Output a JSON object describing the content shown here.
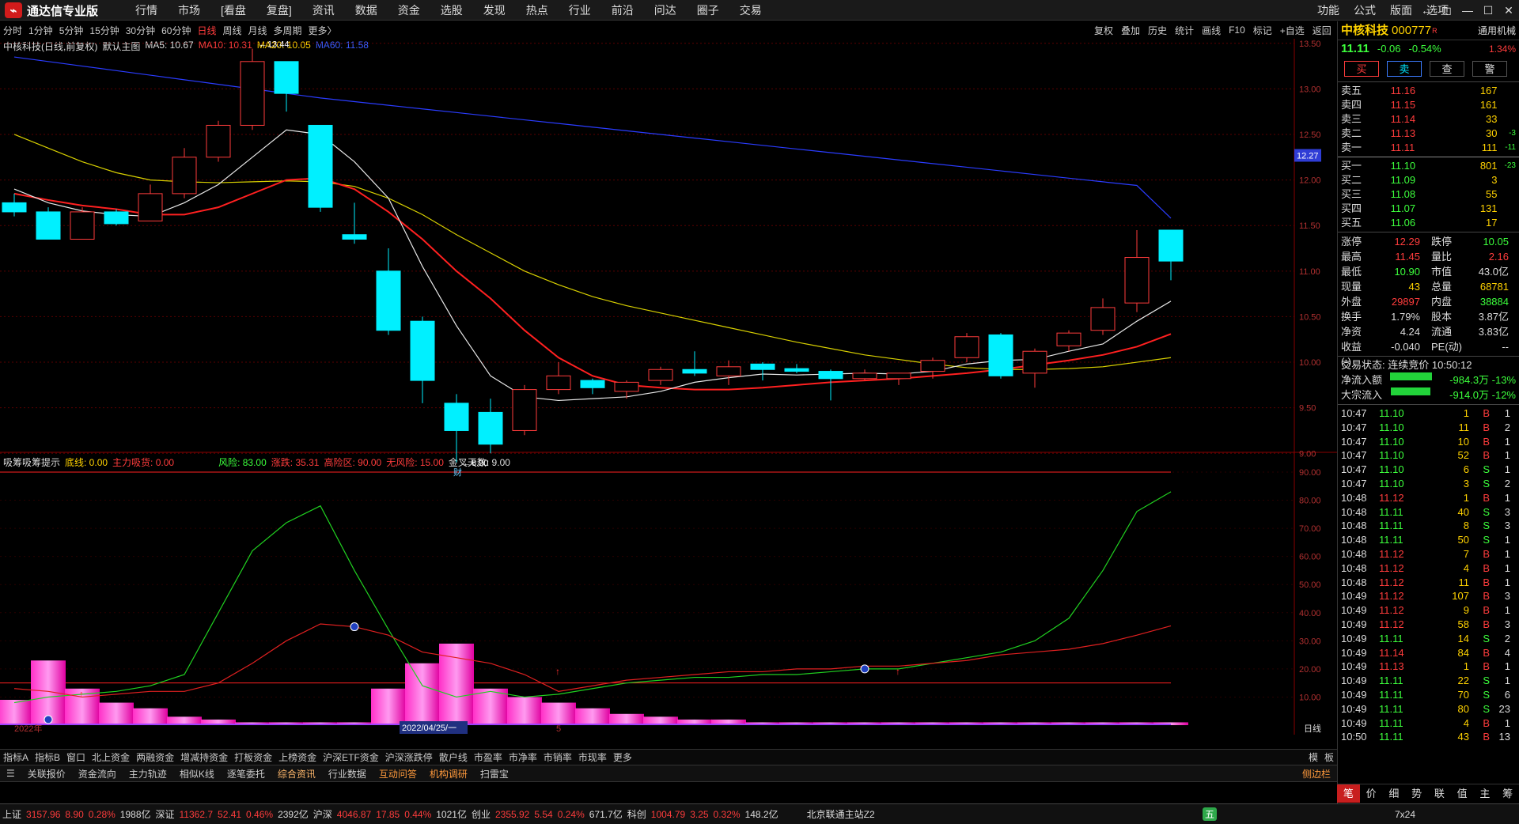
{
  "app": {
    "title": "通达信专业版",
    "menu": [
      "行情",
      "市场",
      "[看盘",
      "复盘]",
      "资讯",
      "数据",
      "资金",
      "选股",
      "发现",
      "热点",
      "行业",
      "前沿",
      "问达",
      "圈子",
      "交易"
    ],
    "right_menu": [
      "功能",
      "公式",
      "版面",
      "选项"
    ],
    "win_controls": [
      "←",
      "◻",
      "—",
      "☐",
      "✕"
    ]
  },
  "periods": [
    "分时",
    "1分钟",
    "5分钟",
    "15分钟",
    "30分钟",
    "60分钟",
    "日线",
    "周线",
    "月线",
    "多周期",
    "更多〉"
  ],
  "chart_tools": [
    "复权",
    "叠加",
    "历史",
    "统计",
    "画线",
    "F10",
    "标记",
    "+自选",
    "返回"
  ],
  "kline_info": {
    "name": "中核科技(日线,前复权)",
    "template": "默认主图",
    "ma5": "MA5: 10.67",
    "ma10": "MA10: 10.31",
    "ma20": "MA20: 10.05",
    "ma60": "MA60: 11.58"
  },
  "indicator_info": {
    "name": "吸筹吸筹提示",
    "a": "底线: 0.00",
    "b": "主力吸货: 0.00",
    "c": "风险: 83.00",
    "d": "涨跌: 35.31",
    "e": "高险区: 90.00",
    "f": "无风险: 15.00",
    "g": "金叉天数: 9.00"
  },
  "annot": {
    "high": "13.44",
    "low": "8.90",
    "fin": "财",
    "price_tag": "12.27",
    "date_label": "2022/04/25/一",
    "year_label": "2022年",
    "month_label": "5",
    "daily": "日线"
  },
  "price_axis": [
    "13.50",
    "13.00",
    "12.50",
    "12.00",
    "11.50",
    "11.00",
    "10.50",
    "10.00",
    "9.50",
    "9.00"
  ],
  "ind_axis": [
    "90.00",
    "80.00",
    "70.00",
    "60.00",
    "50.00",
    "40.00",
    "30.00",
    "20.00",
    "10.00"
  ],
  "chart_data": {
    "type": "candlestick",
    "candles": [
      {
        "o": 11.75,
        "h": 11.85,
        "l": 11.6,
        "c": 11.65
      },
      {
        "o": 11.65,
        "h": 11.7,
        "l": 11.35,
        "c": 11.35
      },
      {
        "o": 11.35,
        "h": 11.7,
        "l": 11.35,
        "c": 11.65
      },
      {
        "o": 11.65,
        "h": 11.68,
        "l": 11.5,
        "c": 11.52
      },
      {
        "o": 11.55,
        "h": 11.95,
        "l": 11.55,
        "c": 11.85
      },
      {
        "o": 11.85,
        "h": 12.35,
        "l": 11.8,
        "c": 12.25
      },
      {
        "o": 12.25,
        "h": 12.65,
        "l": 12.2,
        "c": 12.6
      },
      {
        "o": 12.6,
        "h": 13.44,
        "l": 12.55,
        "c": 13.3
      },
      {
        "o": 13.3,
        "h": 13.3,
        "l": 12.75,
        "c": 12.95
      },
      {
        "o": 12.6,
        "h": 12.6,
        "l": 11.65,
        "c": 11.7
      },
      {
        "o": 11.4,
        "h": 11.75,
        "l": 11.3,
        "c": 11.35
      },
      {
        "o": 11.0,
        "h": 11.25,
        "l": 10.3,
        "c": 10.35
      },
      {
        "o": 10.45,
        "h": 10.5,
        "l": 9.55,
        "c": 9.8
      },
      {
        "o": 9.55,
        "h": 9.65,
        "l": 8.9,
        "c": 9.25
      },
      {
        "o": 9.45,
        "h": 9.6,
        "l": 9.0,
        "c": 9.1
      },
      {
        "o": 9.25,
        "h": 9.75,
        "l": 9.2,
        "c": 9.7
      },
      {
        "o": 9.7,
        "h": 10.0,
        "l": 9.65,
        "c": 9.85
      },
      {
        "o": 9.8,
        "h": 9.82,
        "l": 9.65,
        "c": 9.72
      },
      {
        "o": 9.68,
        "h": 9.8,
        "l": 9.6,
        "c": 9.78
      },
      {
        "o": 9.8,
        "h": 9.95,
        "l": 9.75,
        "c": 9.92
      },
      {
        "o": 9.92,
        "h": 10.12,
        "l": 9.85,
        "c": 9.88
      },
      {
        "o": 9.85,
        "h": 10.02,
        "l": 9.75,
        "c": 9.95
      },
      {
        "o": 9.98,
        "h": 10.0,
        "l": 9.8,
        "c": 9.92
      },
      {
        "o": 9.93,
        "h": 9.98,
        "l": 9.88,
        "c": 9.9
      },
      {
        "o": 9.9,
        "h": 9.92,
        "l": 9.58,
        "c": 9.82
      },
      {
        "o": 9.82,
        "h": 9.92,
        "l": 9.8,
        "c": 9.88
      },
      {
        "o": 9.82,
        "h": 9.88,
        "l": 9.75,
        "c": 9.88
      },
      {
        "o": 9.9,
        "h": 10.05,
        "l": 9.82,
        "c": 10.02
      },
      {
        "o": 10.05,
        "h": 10.32,
        "l": 10.0,
        "c": 10.28
      },
      {
        "o": 10.3,
        "h": 10.32,
        "l": 9.82,
        "c": 9.85
      },
      {
        "o": 9.88,
        "h": 10.15,
        "l": 9.72,
        "c": 10.12
      },
      {
        "o": 10.18,
        "h": 10.35,
        "l": 10.12,
        "c": 10.32
      },
      {
        "o": 10.35,
        "h": 10.7,
        "l": 10.3,
        "c": 10.6
      },
      {
        "o": 10.65,
        "h": 11.45,
        "l": 10.55,
        "c": 11.15
      },
      {
        "o": 11.45,
        "h": 11.45,
        "l": 10.9,
        "c": 11.11
      }
    ],
    "ma5": [
      11.9,
      11.75,
      11.66,
      11.62,
      11.6,
      11.75,
      11.95,
      12.25,
      12.55,
      12.5,
      12.2,
      11.8,
      11.05,
      10.4,
      9.85,
      9.62,
      9.58,
      9.6,
      9.62,
      9.68,
      9.78,
      9.83,
      9.87,
      9.86,
      9.87,
      9.88,
      9.87,
      9.9,
      9.98,
      10.02,
      10.03,
      10.12,
      10.2,
      10.45,
      10.67
    ],
    "ma10": [
      11.85,
      11.78,
      11.72,
      11.68,
      11.62,
      11.62,
      11.7,
      11.85,
      12.0,
      12.02,
      11.9,
      11.65,
      11.35,
      11.0,
      10.7,
      10.35,
      10.05,
      9.85,
      9.75,
      9.72,
      9.7,
      9.7,
      9.72,
      9.75,
      9.78,
      9.8,
      9.82,
      9.85,
      9.88,
      9.92,
      9.97,
      10.02,
      10.08,
      10.17,
      10.31
    ],
    "ma20": [
      12.5,
      12.35,
      12.2,
      12.08,
      12.0,
      11.98,
      11.97,
      11.98,
      11.99,
      11.98,
      11.93,
      11.8,
      11.62,
      11.4,
      11.2,
      11.0,
      10.85,
      10.72,
      10.62,
      10.54,
      10.46,
      10.38,
      10.3,
      10.22,
      10.15,
      10.08,
      10.03,
      9.98,
      9.94,
      9.92,
      9.92,
      9.93,
      9.95,
      10.0,
      10.05
    ],
    "ma60": [
      13.35,
      13.3,
      13.25,
      13.2,
      13.15,
      13.1,
      13.05,
      13.0,
      12.95,
      12.9,
      12.86,
      12.82,
      12.78,
      12.74,
      12.7,
      12.66,
      12.62,
      12.58,
      12.54,
      12.5,
      12.46,
      12.42,
      12.38,
      12.34,
      12.3,
      12.26,
      12.22,
      12.18,
      12.14,
      12.1,
      12.06,
      12.02,
      11.98,
      11.94,
      11.58
    ],
    "risk": [
      8,
      10,
      11,
      12,
      14,
      18,
      40,
      62,
      72,
      78,
      55,
      34,
      14,
      10,
      12,
      10,
      11,
      13,
      15,
      16,
      17,
      17,
      18,
      18,
      19,
      20,
      20,
      22,
      24,
      26,
      30,
      38,
      55,
      76,
      83
    ],
    "trend": [
      13,
      12,
      10,
      11,
      12,
      12,
      15,
      22,
      30,
      36,
      35,
      32,
      26,
      24,
      22,
      18,
      12,
      14,
      16,
      17,
      18,
      19,
      19,
      20,
      20,
      21,
      21,
      22,
      23,
      25,
      26,
      27,
      29,
      32,
      35.31
    ],
    "volume": [
      9,
      23,
      13,
      8,
      6,
      3,
      2,
      1,
      1,
      1,
      1,
      13,
      22,
      29,
      13,
      10,
      8,
      6,
      4,
      3,
      2,
      2,
      1,
      1,
      1,
      1,
      1,
      1,
      1,
      1,
      1,
      1,
      1,
      1,
      1
    ]
  },
  "quote": {
    "name": "中核科技",
    "code": "000777",
    "flag": "R",
    "type_label": "通用机械",
    "price": "11.11",
    "chg": "-0.06",
    "pct": "-0.54%",
    "pct2": "1.34%",
    "buttons": [
      "买",
      "卖",
      "查",
      "警"
    ],
    "asks": [
      [
        "卖五",
        "11.16",
        "167",
        ""
      ],
      [
        "卖四",
        "11.15",
        "161",
        ""
      ],
      [
        "卖三",
        "11.14",
        "33",
        ""
      ],
      [
        "卖二",
        "11.13",
        "30",
        "-3"
      ],
      [
        "卖一",
        "11.11",
        "111",
        "-11"
      ]
    ],
    "bids": [
      [
        "买一",
        "11.10",
        "801",
        "-23"
      ],
      [
        "买二",
        "11.09",
        "3",
        ""
      ],
      [
        "买三",
        "11.08",
        "55",
        ""
      ],
      [
        "买四",
        "11.07",
        "131",
        ""
      ],
      [
        "买五",
        "11.06",
        "17",
        ""
      ]
    ],
    "stats": [
      [
        "涨停",
        "12.29",
        "跌停",
        "10.05"
      ],
      [
        "最高",
        "11.45",
        "量比",
        "2.16"
      ],
      [
        "最低",
        "10.90",
        "市值",
        "43.0亿"
      ],
      [
        "现量",
        "43",
        "总量",
        "68781"
      ],
      [
        "外盘",
        "29897",
        "内盘",
        "38884"
      ],
      [
        "换手",
        "1.79%",
        "股本",
        "3.87亿"
      ],
      [
        "净资",
        "4.24",
        "流通",
        "3.83亿"
      ],
      [
        "收益(-)",
        "-0.040",
        "PE(动)",
        "--"
      ]
    ],
    "status": "交易状态: 连续竞价 10:50:12",
    "flows": [
      [
        "净流入额",
        "-984.3万",
        "-13%"
      ],
      [
        "大宗流入",
        "-914.0万",
        "-12%"
      ]
    ],
    "ticks": [
      [
        "10:47",
        "11.10",
        "1",
        "B",
        "1"
      ],
      [
        "10:47",
        "11.10",
        "11",
        "B",
        "2"
      ],
      [
        "10:47",
        "11.10",
        "10",
        "B",
        "1"
      ],
      [
        "10:47",
        "11.10",
        "52",
        "B",
        "1"
      ],
      [
        "10:47",
        "11.10",
        "6",
        "S",
        "1"
      ],
      [
        "10:47",
        "11.10",
        "3",
        "S",
        "2"
      ],
      [
        "10:48",
        "11.12",
        "1",
        "B",
        "1"
      ],
      [
        "10:48",
        "11.11",
        "40",
        "S",
        "3"
      ],
      [
        "10:48",
        "11.11",
        "8",
        "S",
        "3"
      ],
      [
        "10:48",
        "11.11",
        "50",
        "S",
        "1"
      ],
      [
        "10:48",
        "11.12",
        "7",
        "B",
        "1"
      ],
      [
        "10:48",
        "11.12",
        "4",
        "B",
        "1"
      ],
      [
        "10:48",
        "11.12",
        "11",
        "B",
        "1"
      ],
      [
        "10:49",
        "11.12",
        "107",
        "B",
        "3"
      ],
      [
        "10:49",
        "11.12",
        "9",
        "B",
        "1"
      ],
      [
        "10:49",
        "11.12",
        "58",
        "B",
        "3"
      ],
      [
        "10:49",
        "11.11",
        "14",
        "S",
        "2"
      ],
      [
        "10:49",
        "11.14",
        "84",
        "B",
        "4"
      ],
      [
        "10:49",
        "11.13",
        "1",
        "B",
        "1"
      ],
      [
        "10:49",
        "11.11",
        "22",
        "S",
        "1"
      ],
      [
        "10:49",
        "11.11",
        "70",
        "S",
        "6"
      ],
      [
        "10:49",
        "11.11",
        "80",
        "S",
        "23"
      ],
      [
        "10:49",
        "11.11",
        "4",
        "B",
        "1"
      ],
      [
        "10:50",
        "11.11",
        "43",
        "B",
        "13"
      ]
    ],
    "bottom_tabs": [
      "笔",
      "价",
      "细",
      "势",
      "联",
      "值",
      "主",
      "筹"
    ]
  },
  "tabs1": [
    "指标A",
    "指标B",
    "窗口",
    "北上资金",
    "两融资金",
    "增减持资金",
    "打板资金",
    "上榜资金",
    "沪深ETF资金",
    "沪深涨跌停",
    "散户线",
    "市盈率",
    "市净率",
    "市销率",
    "市现率",
    "更多"
  ],
  "tabs1_right": [
    "模",
    "板"
  ],
  "tabs2": [
    "关联报价",
    "资金流向",
    "主力轨迹",
    "相似K线",
    "逐笔委托",
    "综合资讯",
    "行业数据",
    "互动问答",
    "机构调研",
    "扫雷宝"
  ],
  "tabs2_right": "侧边栏",
  "statusbar": {
    "sh": [
      "上证",
      "3157.96",
      "8.90",
      "0.28%",
      "1988亿"
    ],
    "sz": [
      "深证",
      "11362.7",
      "52.41",
      "0.46%",
      "2392亿"
    ],
    "hs": [
      "沪深",
      "4046.87",
      "17.85",
      "0.44%",
      "1021亿"
    ],
    "cy": [
      "创业",
      "2355.92",
      "5.54",
      "0.24%",
      "671.7亿"
    ],
    "kc": [
      "科创",
      "1004.79",
      "3.25",
      "0.32%",
      "148.2亿"
    ],
    "server": "北京联通主站Z2",
    "time": "7x24",
    "ime": "五"
  }
}
